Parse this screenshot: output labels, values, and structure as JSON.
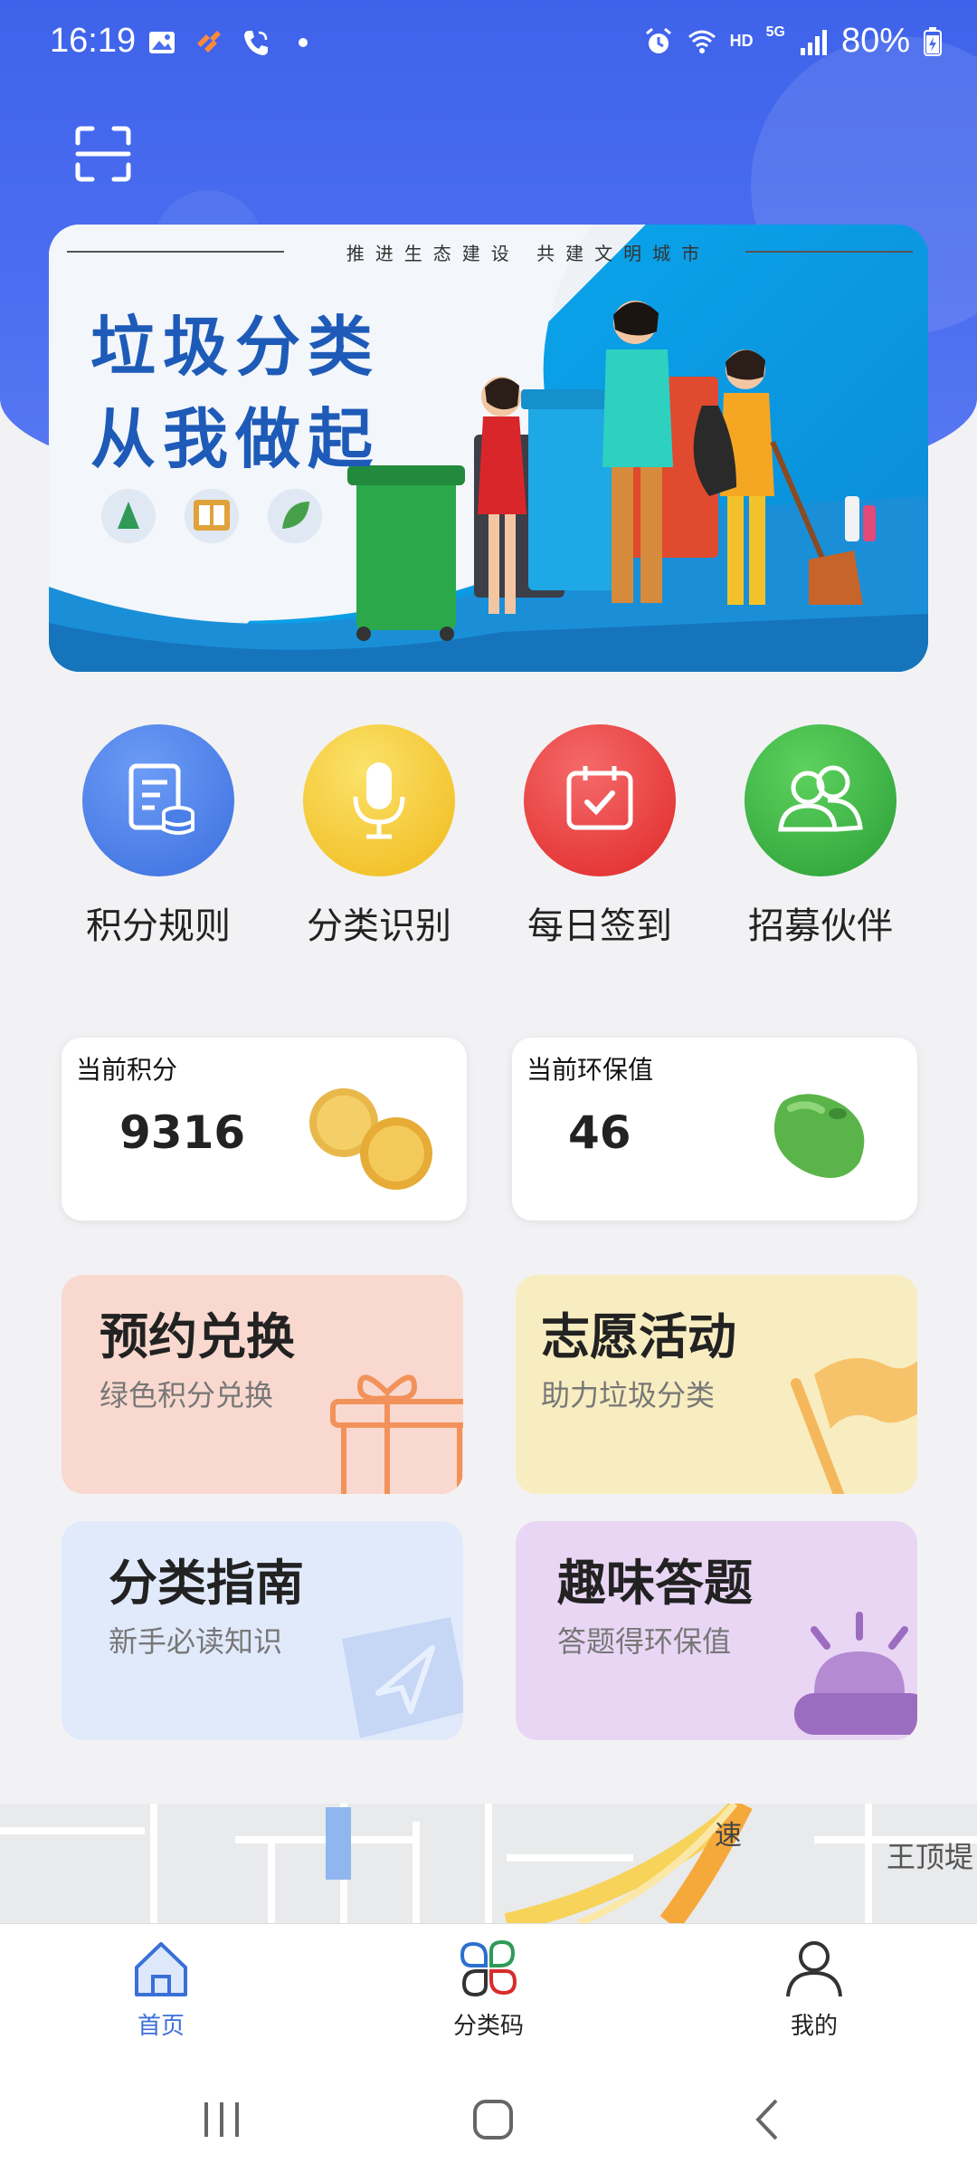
{
  "status_bar": {
    "time": "16:19",
    "battery": "80%",
    "network": "HD",
    "net_gen": "5G"
  },
  "banner": {
    "slogan": "推进生态建设 共建文明城市",
    "title_line1": "垃圾分类",
    "title_line2": "从我做起"
  },
  "quick_actions": [
    {
      "label": "积分规则",
      "icon": "document-database-icon",
      "color": "#4a7fe8"
    },
    {
      "label": "分类识别",
      "icon": "microphone-icon",
      "color": "#f2c21c"
    },
    {
      "label": "每日签到",
      "icon": "calendar-check-icon",
      "color": "#ec3b3b"
    },
    {
      "label": "招募伙伴",
      "icon": "users-icon",
      "color": "#3bb24a"
    }
  ],
  "points": {
    "current_points_label": "当前积分",
    "current_points_value": "9316",
    "eco_value_label": "当前环保值",
    "eco_value": "46"
  },
  "tiles": [
    {
      "title": "预约兑换",
      "subtitle": "绿色积分兑换",
      "icon": "gift-icon",
      "bg": "#f9d9cf"
    },
    {
      "title": "志愿活动",
      "subtitle": "助力垃圾分类",
      "icon": "flag-icon",
      "bg": "#f8edc0"
    },
    {
      "title": "分类指南",
      "subtitle": "新手必读知识",
      "icon": "guide-book-icon",
      "bg": "#e1eafb"
    },
    {
      "title": "趣味答题",
      "subtitle": "答题得环保值",
      "icon": "buzzer-icon",
      "bg": "#e9d6f4"
    }
  ],
  "map": {
    "place_label": "王顶堤",
    "road_label": "速"
  },
  "bottom_nav": [
    {
      "label": "首页",
      "icon": "home-icon",
      "active": true
    },
    {
      "label": "分类码",
      "icon": "category-code-icon",
      "active": false
    },
    {
      "label": "我的",
      "icon": "profile-icon",
      "active": false
    }
  ]
}
